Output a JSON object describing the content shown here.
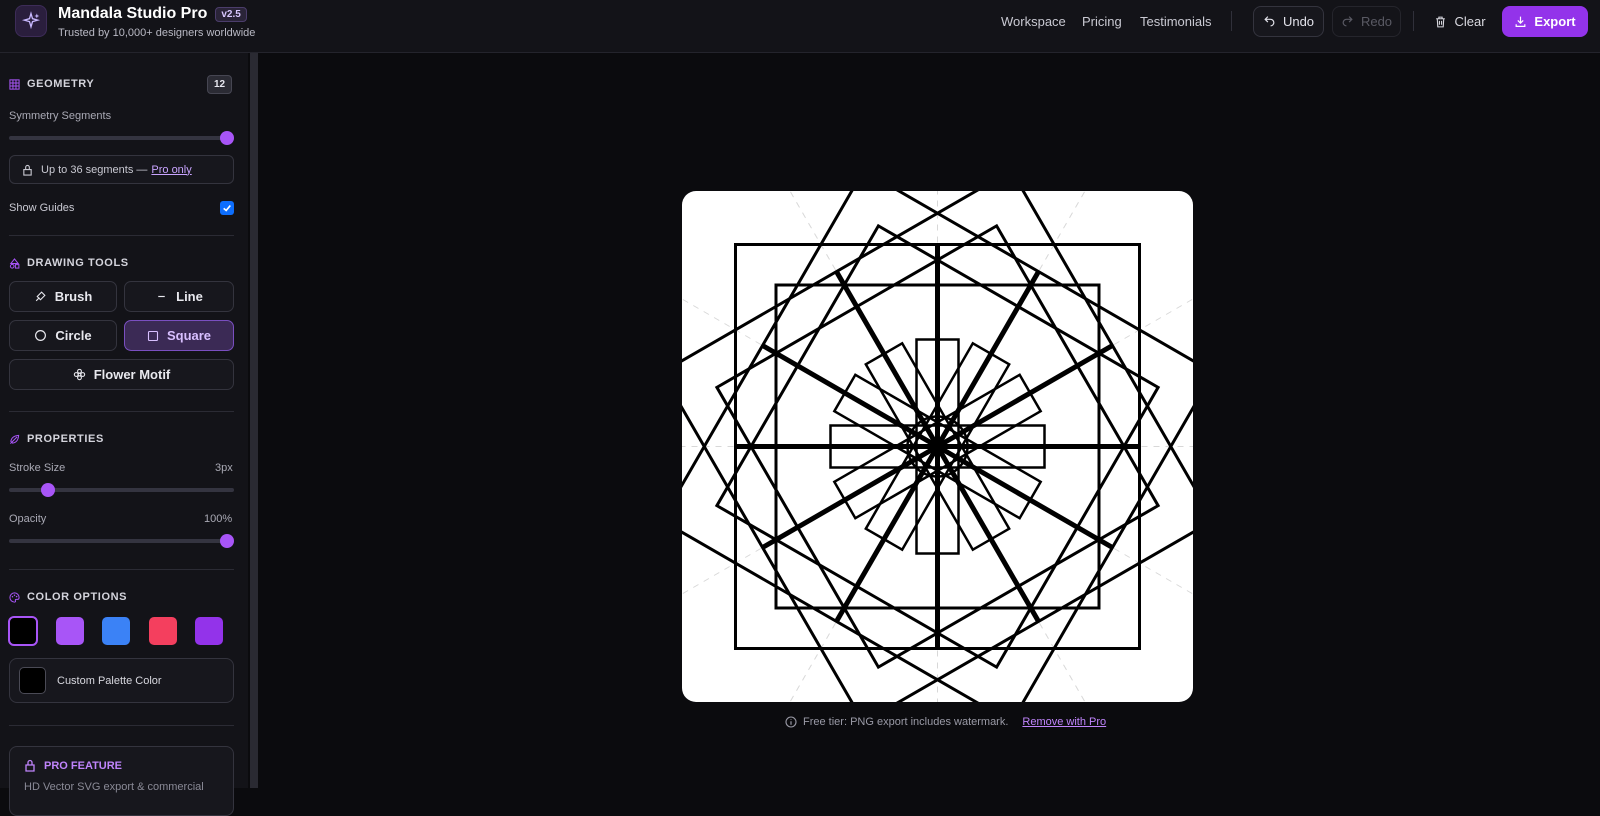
{
  "app": {
    "title": "Mandala Studio Pro",
    "version": "v2.5",
    "subtitle": "Trusted by 10,000+ designers worldwide"
  },
  "nav": {
    "workspace": "Workspace",
    "pricing": "Pricing",
    "testimonials": "Testimonials"
  },
  "toolbar": {
    "undo": "Undo",
    "redo": "Redo",
    "clear": "Clear",
    "export": "Export"
  },
  "geometry": {
    "title": "GEOMETRY",
    "segments": "12",
    "symmetry_label": "Symmetry Segments",
    "symmetry_level": 1.0,
    "lock_text": "Up to 36 segments —",
    "pro_link": "Pro only",
    "guides_label": "Show Guides",
    "guides_checked": true
  },
  "drawing_tools": {
    "title": "DRAWING TOOLS",
    "brush": "Brush",
    "line": "Line",
    "circle": "Circle",
    "square": "Square",
    "flower": "Flower Motif",
    "active": "square"
  },
  "properties": {
    "title": "PROPERTIES",
    "stroke_label": "Stroke Size",
    "stroke_value": "3px",
    "stroke_level": 0.15,
    "opacity_label": "Opacity",
    "opacity_value": "100%",
    "opacity_level": 1.0
  },
  "colors": {
    "title": "COLOR OPTIONS",
    "swatches": [
      "#000000",
      "#a855f7",
      "#3b82f6",
      "#f43f5e",
      "#9333ea"
    ],
    "selected": "#000000",
    "custom_label": "Custom Palette Color"
  },
  "pro_feature": {
    "title": "PRO FEATURE",
    "description": "HD Vector SVG export & commercial"
  },
  "footer": {
    "note": "Free tier: PNG export includes watermark.",
    "link": "Remove with Pro"
  },
  "theme": {
    "accent": "#9333ea",
    "accent_light": "#a855f7"
  }
}
